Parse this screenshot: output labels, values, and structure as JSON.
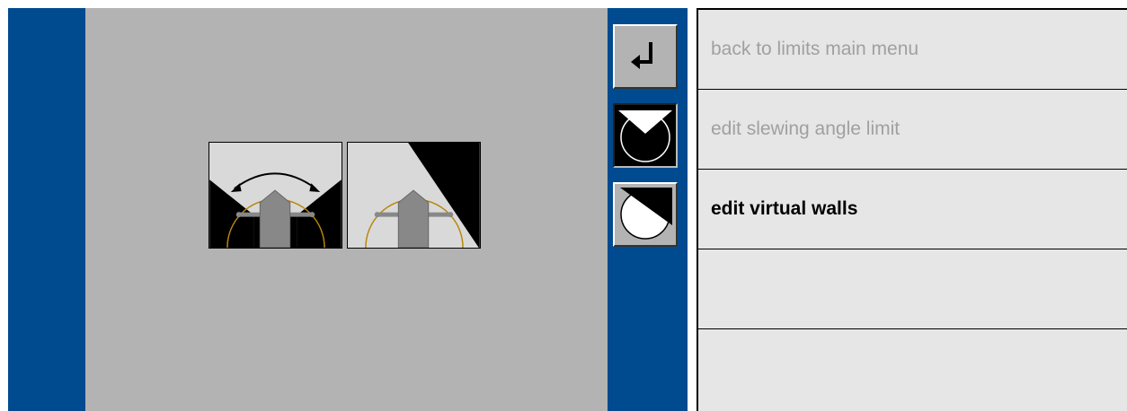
{
  "softkeys": [
    {
      "icon": "return-arrow-icon",
      "state": "normal"
    },
    {
      "icon": "slewing-angle-limit-icon",
      "state": "active"
    },
    {
      "icon": "virtual-wall-icon",
      "state": "normal"
    }
  ],
  "illustrations": [
    {
      "icon": "slewing-angle-illustration"
    },
    {
      "icon": "virtual-wall-illustration"
    }
  ],
  "menu": {
    "items": [
      {
        "label": "back to limits main menu",
        "selected": false
      },
      {
        "label": "edit slewing angle limit",
        "selected": false
      },
      {
        "label": "edit virtual walls",
        "selected": true
      },
      {
        "label": "",
        "selected": false
      },
      {
        "label": "",
        "selected": false
      }
    ]
  },
  "colors": {
    "side_bar": "#004a8f",
    "content_bg": "#b3b3b3",
    "menu_bg": "#e6e6e6",
    "menu_text_inactive": "#a0a0a0",
    "menu_text_selected": "#000000",
    "arc": "#b8860b"
  }
}
